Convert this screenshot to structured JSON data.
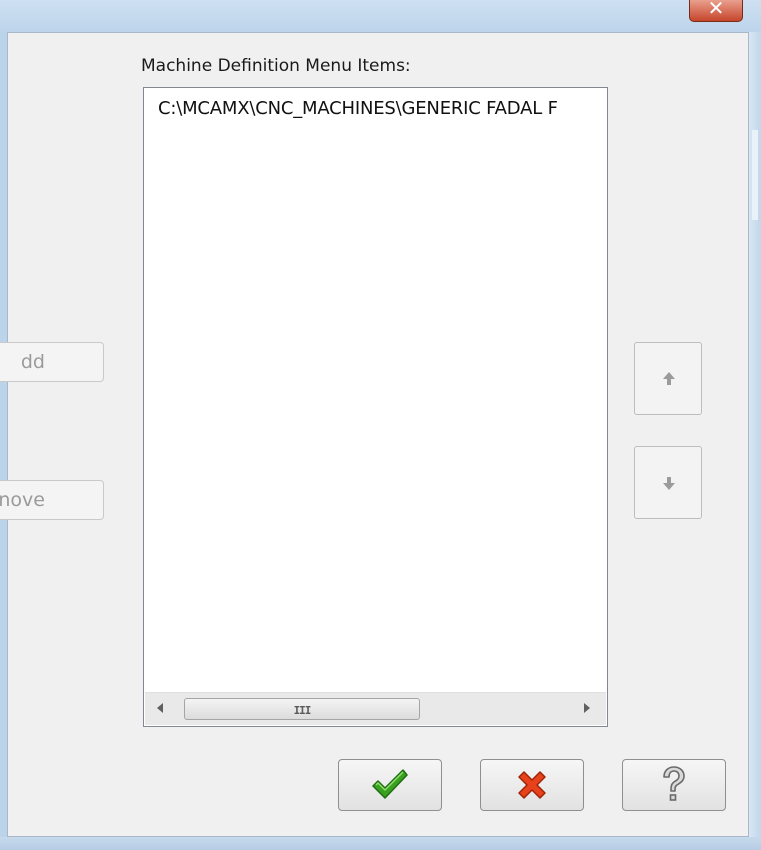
{
  "dialog": {
    "close_glyph": "✕",
    "list_label": "Machine Definition Menu Items:",
    "list_items": [
      "C:\\MCAMX\\CNC_MACHINES\\GENERIC FADAL F"
    ],
    "scrollbar_grip": "III",
    "buttons": {
      "add_label_partial": "dd",
      "remove_label_partial": "nove",
      "move_up": "arrow-up-icon",
      "move_down": "arrow-down-icon",
      "ok": "checkmark-icon",
      "cancel": "red-x-icon",
      "help": "question-mark-icon"
    },
    "colors": {
      "ok_green": "#3aa020",
      "cancel_red": "#e8421c",
      "help_gray": "#7a7a7a",
      "disabled_text": "#9a9a9a"
    }
  }
}
